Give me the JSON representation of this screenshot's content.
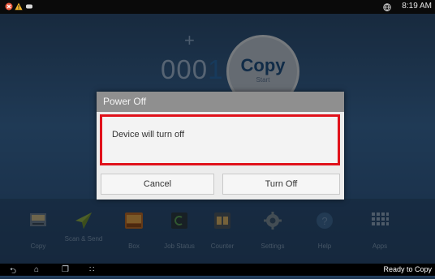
{
  "status_bar": {
    "time": "8:19 AM",
    "icons": [
      "error-icon",
      "warning-icon",
      "notification-icon",
      "globe-icon"
    ],
    "colors": {
      "error": "#e8583d",
      "warning": "#f0b42a"
    }
  },
  "copy_screen": {
    "plus": "+",
    "counter_prefix": "000",
    "counter_last": "1",
    "copy_button": {
      "label": "Copy",
      "sub": "Start"
    }
  },
  "apps": [
    {
      "label": "Copy",
      "icon": "copy-icon"
    },
    {
      "label": "Scan & Send",
      "icon": "scan-send-icon"
    },
    {
      "label": "Box",
      "icon": "box-icon"
    },
    {
      "label": "Job Status",
      "icon": "job-status-icon"
    },
    {
      "label": "Counter",
      "icon": "counter-icon"
    },
    {
      "label": "Settings",
      "icon": "settings-icon"
    },
    {
      "label": "Help",
      "icon": "help-icon"
    },
    {
      "label": "Apps",
      "icon": "apps-grid-icon"
    }
  ],
  "nav_bar": {
    "status": "Ready to Copy",
    "icons": [
      "back-icon",
      "home-icon",
      "recent-apps-icon",
      "grid-icon"
    ]
  },
  "dialog": {
    "title": "Power Off",
    "message": "Device will turn off",
    "cancel_label": "Cancel",
    "confirm_label": "Turn Off",
    "highlight_color": "#e0121b"
  }
}
